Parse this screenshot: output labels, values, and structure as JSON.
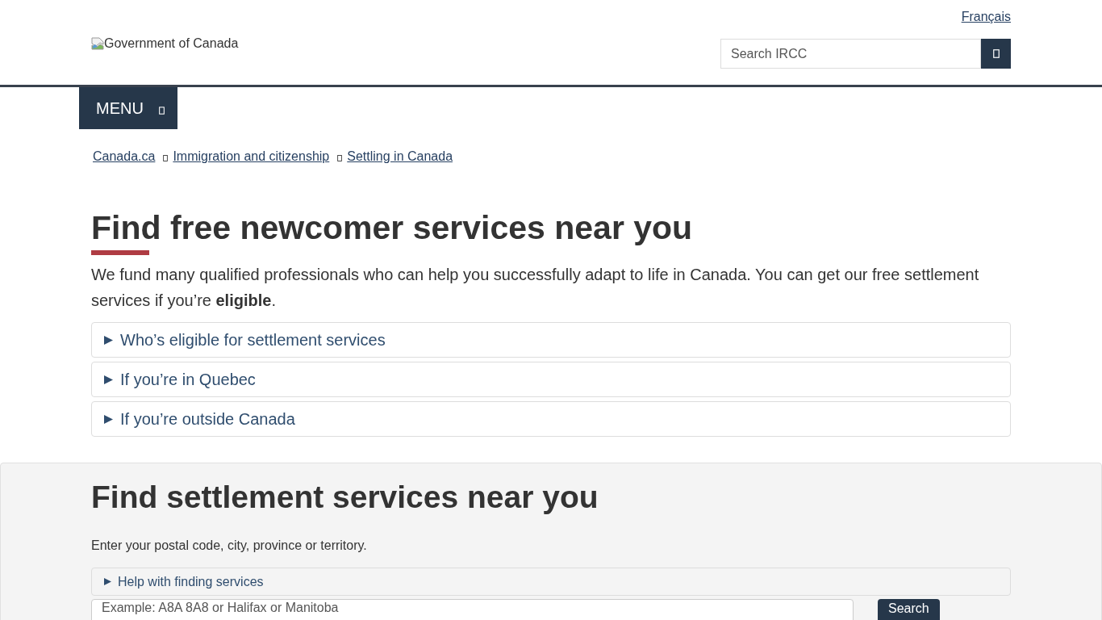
{
  "header": {
    "language_link": "Français",
    "logo_alt": "Government of Canada",
    "search": {
      "placeholder": "Search IRCC"
    }
  },
  "menu_button": {
    "label": "MENU"
  },
  "breadcrumbs": [
    "Canada.ca",
    "Immigration and citizenship",
    "Settling in Canada"
  ],
  "main": {
    "title": "Find free newcomer services near you",
    "intro": "We fund many qualified professionals who can help you successfully adapt to life in Canada. You can get our free settlement services if you’re **eligible**.",
    "details": [
      {
        "summary": "Who’s eligible for settlement services",
        "expanded": false
      },
      {
        "summary": "If you’re in Quebec",
        "expanded": false
      },
      {
        "summary": "If you’re outside Canada",
        "expanded": false
      }
    ]
  },
  "finder": {
    "title": "Find settlement services near you",
    "instructions": "Enter your postal code, city, province or territory.",
    "help": {
      "summary": "Help with finding services",
      "expanded": false
    },
    "location_field": {
      "placeholder": "Example: A8A 8A8 or Halifax or Manitoba"
    },
    "search_button": "Search"
  }
}
